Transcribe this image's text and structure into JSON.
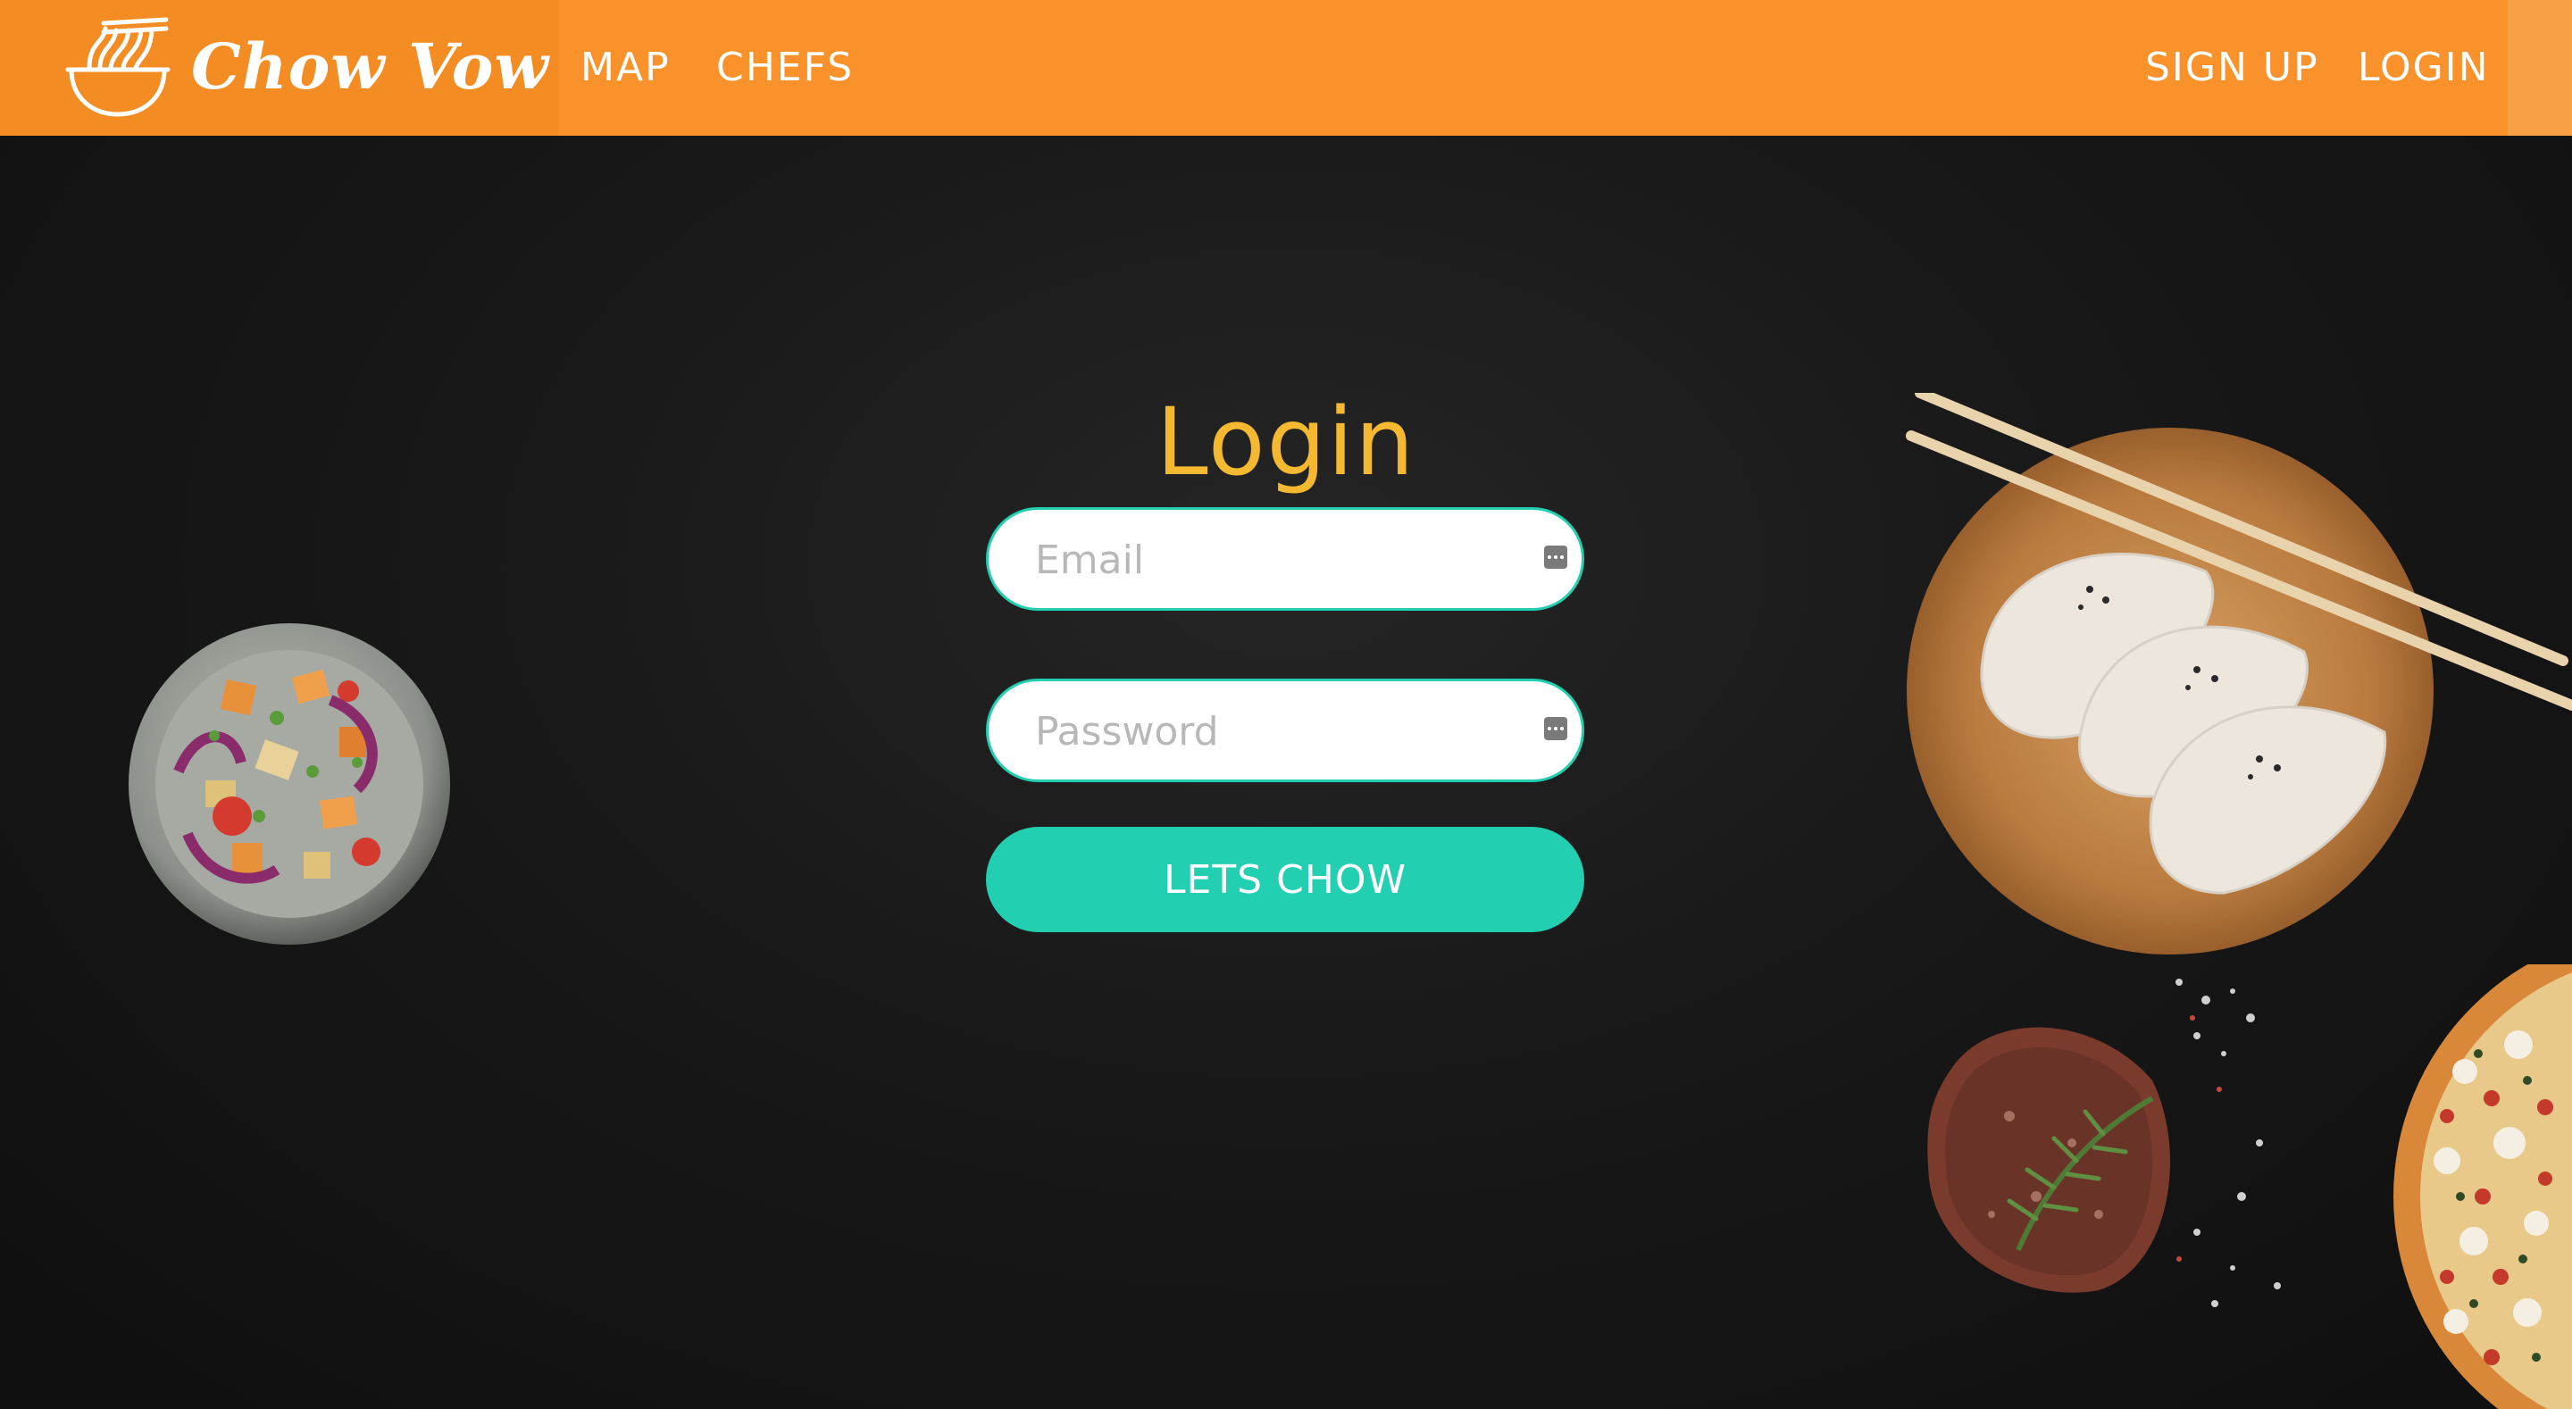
{
  "navbar": {
    "brand_name": "Chow Vow",
    "brand_icon": "noodle-bowl-icon",
    "links": {
      "map": "MAP",
      "chefs": "CHEFS",
      "signup": "SIGN UP",
      "login": "LOGIN"
    }
  },
  "login_form": {
    "title": "Login",
    "email_placeholder": "Email",
    "password_placeholder": "Password",
    "submit_label": "LETS CHOW",
    "autofill_icon": "password-key-icon"
  },
  "decoration": {
    "images": [
      "salad-bowl",
      "dumpling-plate-with-chopsticks",
      "steak-with-rosemary",
      "pizza"
    ]
  },
  "colors": {
    "navbar_bg": "#fa922b",
    "brand_bg": "#f48c24",
    "title_color": "#f4b930",
    "accent": "#22cfb1",
    "background": "#131313"
  }
}
